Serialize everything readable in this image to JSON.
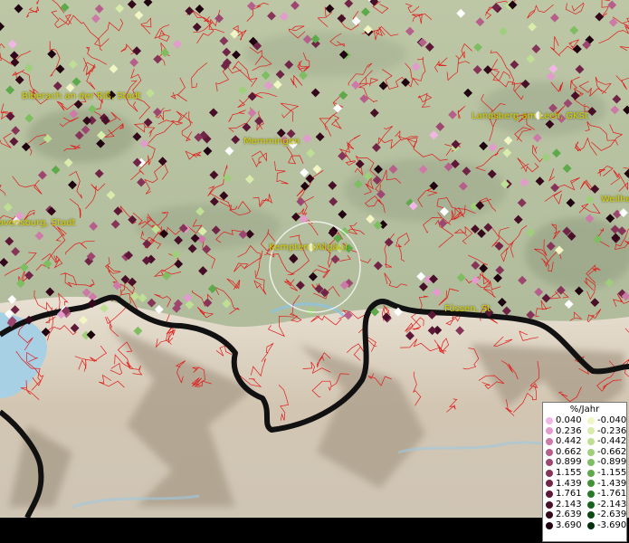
{
  "map": {
    "cities": [
      {
        "name": "Biberach an der Riß, Stadt"
      },
      {
        "name": "Memmingen"
      },
      {
        "name": "Landsberg am Lech, GKSt"
      },
      {
        "name": "Weilheim"
      },
      {
        "name": "Ravensburg, Stadt"
      },
      {
        "name": "Kempten (Allgäu)"
      },
      {
        "name": "Füssen, St"
      }
    ]
  },
  "legend": {
    "title": "%/Jahr",
    "positive": [
      {
        "label": "0.040",
        "color": "#f2b6e6"
      },
      {
        "label": "0.236",
        "color": "#e29bcc"
      },
      {
        "label": "0.442",
        "color": "#cd7aa8"
      },
      {
        "label": "0.662",
        "color": "#b65f8a"
      },
      {
        "label": "0.899",
        "color": "#9d4670"
      },
      {
        "label": "1.155",
        "color": "#863559"
      },
      {
        "label": "1.439",
        "color": "#702546"
      },
      {
        "label": "1.761",
        "color": "#5c1836"
      },
      {
        "label": "2.143",
        "color": "#480f28"
      },
      {
        "label": "2.639",
        "color": "#33081b"
      },
      {
        "label": "3.690",
        "color": "#1f0310"
      }
    ],
    "negative": [
      {
        "label": "-0.040",
        "color": "#f2f5c4"
      },
      {
        "label": "-0.236",
        "color": "#d9ecab"
      },
      {
        "label": "-0.442",
        "color": "#bfe094"
      },
      {
        "label": "-0.662",
        "color": "#9fcf7a"
      },
      {
        "label": "-0.899",
        "color": "#7fbd62"
      },
      {
        "label": "-1.155",
        "color": "#5ea94a"
      },
      {
        "label": "-1.439",
        "color": "#3f9236"
      },
      {
        "label": "-1.761",
        "color": "#287a28"
      },
      {
        "label": "-2.143",
        "color": "#17621c"
      },
      {
        "label": "-2.639",
        "color": "#0b4a12"
      },
      {
        "label": "-3.690",
        "color": "#03300a"
      }
    ]
  }
}
